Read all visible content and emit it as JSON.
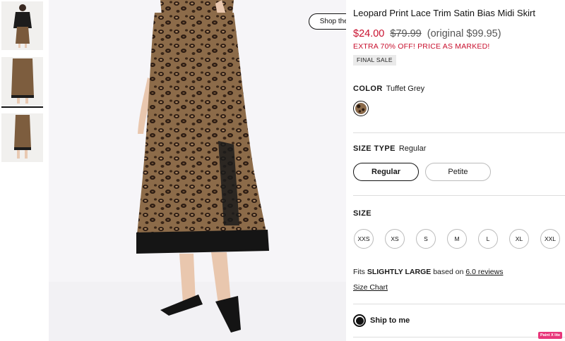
{
  "product": {
    "title": "Leopard Print Lace Trim Satin Bias Midi Skirt",
    "price_now": "$24.00",
    "price_was": "$79.99",
    "price_original": "(original $99.95)",
    "promo": "EXTRA 70% OFF! PRICE AS MARKED!",
    "final_sale": "FINAL SALE"
  },
  "gallery": {
    "shop_the_look": "Shop the Look",
    "thumbnails": [
      "thumbnail-1",
      "thumbnail-2",
      "thumbnail-3"
    ],
    "selected_index": 1
  },
  "color": {
    "label": "COLOR",
    "value": "Tuffet Grey",
    "swatch": "leopard-print"
  },
  "size_type": {
    "label": "SIZE TYPE",
    "value": "Regular",
    "options": [
      "Regular",
      "Petite"
    ]
  },
  "size": {
    "label": "SIZE",
    "options": [
      "XXS",
      "XS",
      "S",
      "M",
      "L",
      "XL",
      "XXL"
    ]
  },
  "fit": {
    "prefix": "Fits",
    "strength": "SLIGHTLY LARGE",
    "middle": "based on",
    "reviews_link": "6.0 reviews"
  },
  "size_chart": "Size Chart",
  "shipping": {
    "label": "Ship to me",
    "selected": true
  },
  "badge": "Paint X lite",
  "colors": {
    "sale_red": "#c8102e",
    "text": "#111111",
    "border": "#bbbbbb"
  }
}
